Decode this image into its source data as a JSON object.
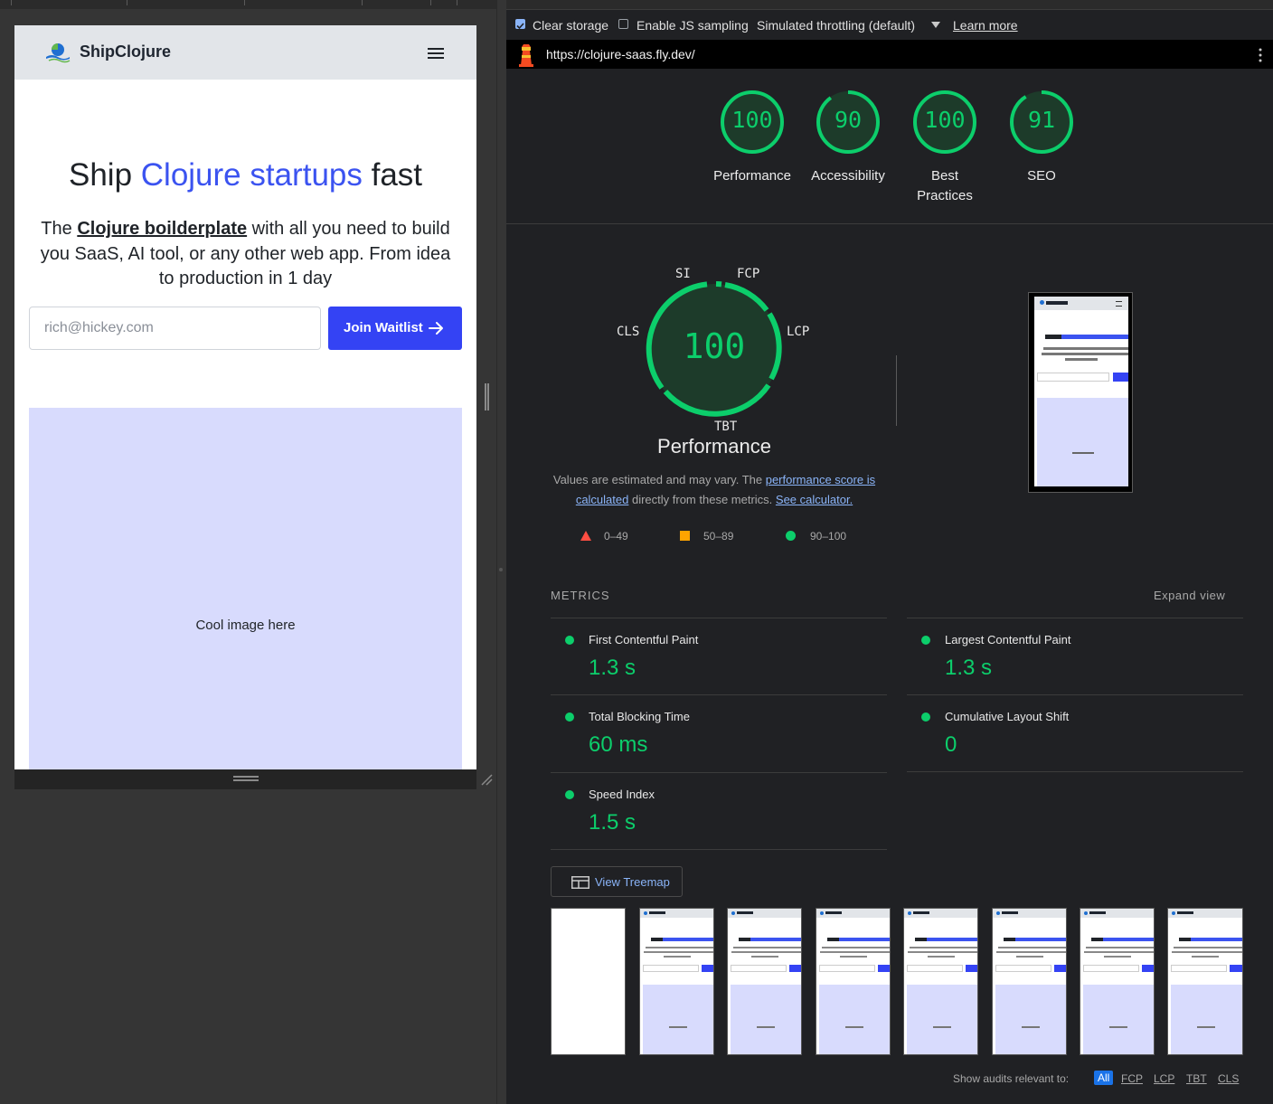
{
  "left": {
    "site": {
      "brand": "ShipClojure",
      "hero_prefix": "Ship ",
      "hero_accent": "Clojure startups",
      "hero_suffix": " fast",
      "sub_prefix": "The ",
      "sub_link": "Clojure boilderplate",
      "sub_suffix": " with all you need to build you SaaS, AI tool, or any other web app. From idea to production in 1 day",
      "email_placeholder": "rich@hickey.com",
      "join_label": "Join Waitlist",
      "image_text": "Cool image here"
    }
  },
  "toolbar": {
    "clear_storage": "Clear storage",
    "js_sampling": "Enable JS sampling",
    "throttling": "Simulated throttling (default)",
    "learn_more": "Learn more"
  },
  "url": "https://clojure-saas.fly.dev/",
  "scores": [
    {
      "label": "Performance",
      "value": "100",
      "fraction": 1.0
    },
    {
      "label": "Accessibility",
      "value": "90",
      "fraction": 0.9
    },
    {
      "label": "Best Practices",
      "value": "100",
      "fraction": 1.0
    },
    {
      "label": "SEO",
      "value": "91",
      "fraction": 0.91
    }
  ],
  "performance": {
    "score": "100",
    "title": "Performance",
    "metric_labels": {
      "si": "SI",
      "fcp": "FCP",
      "lcp": "LCP",
      "tbt": "TBT",
      "cls": "CLS"
    },
    "estimate_prefix": "Values are estimated and may vary. The ",
    "estimate_link": "performance score is calculated",
    "estimate_middle": " directly from these metrics. ",
    "estimate_link2": "See calculator.",
    "legend": {
      "fail": "0–49",
      "average": "50–89",
      "pass": "90–100"
    }
  },
  "metrics": {
    "header": "METRICS",
    "expand": "Expand view",
    "items": [
      {
        "name": "First Contentful Paint",
        "value": "1.3 s"
      },
      {
        "name": "Largest Contentful Paint",
        "value": "1.3 s"
      },
      {
        "name": "Total Blocking Time",
        "value": "60 ms"
      },
      {
        "name": "Cumulative Layout Shift",
        "value": "0"
      },
      {
        "name": "Speed Index",
        "value": "1.5 s"
      }
    ]
  },
  "treemap_label": "View Treemap",
  "filter": {
    "label": "Show audits relevant to:",
    "all": "All",
    "fcp": "FCP",
    "lcp": "LCP",
    "tbt": "TBT",
    "cls": "CLS"
  },
  "colors": {
    "pass": "#0cce6b",
    "accent": "#3b53f0",
    "link": "#8ab4f8"
  }
}
